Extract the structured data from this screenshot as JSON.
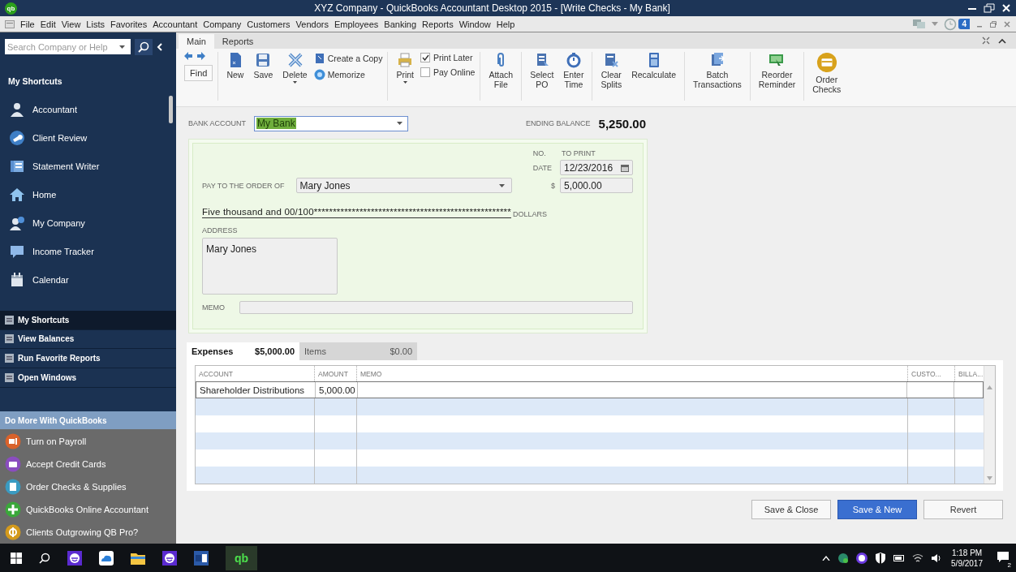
{
  "window": {
    "logo": "qb",
    "title": "XYZ Company  - QuickBooks Accountant Desktop 2015 - [Write Checks - My Bank]"
  },
  "menu": [
    "File",
    "Edit",
    "View",
    "Lists",
    "Favorites",
    "Accountant",
    "Company",
    "Customers",
    "Vendors",
    "Employees",
    "Banking",
    "Reports",
    "Window",
    "Help"
  ],
  "alerts_count": "4",
  "sidebar": {
    "search": {
      "placeholder": "Search Company or Help"
    },
    "header": "My Shortcuts",
    "items": [
      "Accountant",
      "Client Review",
      "Statement Writer",
      "Home",
      "My Company",
      "Income Tracker",
      "Calendar"
    ],
    "panels": [
      {
        "label": "My Shortcuts",
        "selected": true
      },
      {
        "label": "View Balances",
        "selected": false
      },
      {
        "label": "Run Favorite Reports",
        "selected": false
      },
      {
        "label": "Open Windows",
        "selected": false
      }
    ],
    "promo": {
      "title": "Do More With QuickBooks",
      "items": [
        "Turn on Payroll",
        "Accept Credit Cards",
        "Order Checks & Supplies",
        "QuickBooks Online Accountant",
        "Clients Outgrowing QB Pro?"
      ]
    }
  },
  "tabs": [
    {
      "label": "Main",
      "selected": true
    },
    {
      "label": "Reports",
      "selected": false
    }
  ],
  "toolbar": [
    [
      {
        "kind": "find",
        "label": "Find"
      }
    ],
    [
      {
        "kind": "button",
        "label": "New"
      },
      {
        "kind": "button",
        "label": "Save"
      },
      {
        "kind": "button",
        "label": "Delete",
        "menu": true
      },
      {
        "kind": "stack",
        "items": [
          "Create a Copy",
          "Memorize"
        ]
      }
    ],
    [
      {
        "kind": "button",
        "label": "Print",
        "menu": true
      },
      {
        "kind": "checks",
        "items": [
          {
            "label": "Print Later",
            "checked": true
          },
          {
            "label": "Pay Online",
            "checked": false
          }
        ]
      }
    ],
    [
      {
        "kind": "button",
        "label": "Attach File"
      }
    ],
    [
      {
        "kind": "button",
        "label": "Select PO"
      },
      {
        "kind": "button",
        "label": "Enter Time"
      }
    ],
    [
      {
        "kind": "button",
        "label": "Clear Splits"
      },
      {
        "kind": "button",
        "label": "Recalculate"
      }
    ],
    [
      {
        "kind": "button",
        "label": "Batch Transactions"
      }
    ],
    [
      {
        "kind": "button",
        "label": "Reorder Reminder"
      }
    ],
    [
      {
        "kind": "button",
        "label": "Order Checks"
      }
    ]
  ],
  "bank_account": {
    "label": "BANK ACCOUNT",
    "value": "My Bank"
  },
  "ending_balance": {
    "label": "ENDING BALANCE",
    "value": "5,250.00"
  },
  "check": {
    "no_label": "NO.",
    "no_value": "TO PRINT",
    "date_label": "DATE",
    "date": "12/23/2016",
    "payee_label": "PAY TO THE ORDER OF",
    "payee": "Mary Jones",
    "dollar_sign": "$",
    "amount": "5,000.00",
    "amount_words": "Five thousand  and 00/100****************************************************",
    "dollars_label": "DOLLARS",
    "address_label": "ADDRESS",
    "address": "Mary Jones",
    "memo_label": "MEMO"
  },
  "split_tabs": [
    {
      "label": "Expenses",
      "amount": "$5,000.00",
      "selected": true
    },
    {
      "label": "Items",
      "amount": "$0.00",
      "selected": false
    }
  ],
  "table": {
    "columns": [
      "ACCOUNT",
      "AMOUNT",
      "MEMO",
      "CUSTO...",
      "BILLA..."
    ],
    "rows": [
      [
        "Shareholder Distributions",
        "5,000.00"
      ]
    ]
  },
  "buttons": [
    {
      "label": "Save & Close",
      "primary": false
    },
    {
      "label": "Save & New",
      "primary": true
    },
    {
      "label": "Revert",
      "primary": false
    }
  ],
  "taskbar": {
    "app_label": "qb",
    "time": "1:18 PM",
    "date": "5/9/2017",
    "notifications": "2"
  }
}
